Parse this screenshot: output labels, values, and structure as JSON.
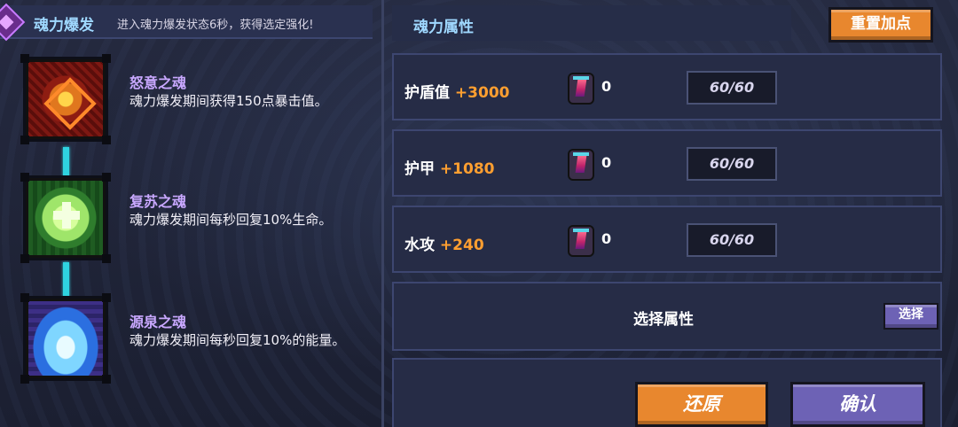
{
  "soul_burst": {
    "title": "魂力爆发",
    "description": "进入魂力爆发状态6秒，获得选定强化!"
  },
  "souls": [
    {
      "name": "怒意之魂",
      "description": "魂力爆发期间获得150点暴击值。",
      "icon": "rage-soul-icon"
    },
    {
      "name": "复苏之魂",
      "description": "魂力爆发期间每秒回复10%生命。",
      "icon": "revive-soul-icon"
    },
    {
      "name": "源泉之魂",
      "description": "魂力爆发期间每秒回复10%的能量。",
      "icon": "source-soul-icon"
    }
  ],
  "attributes_panel": {
    "title": "魂力属性",
    "reset_label": "重置加点"
  },
  "attributes": [
    {
      "name": "护盾值",
      "bonus": "+3000",
      "gem_count": "0",
      "level": "60/60"
    },
    {
      "name": "护甲",
      "bonus": "+1080",
      "gem_count": "0",
      "level": "60/60"
    },
    {
      "name": "水攻",
      "bonus": "+240",
      "gem_count": "0",
      "level": "60/60"
    }
  ],
  "select_attribute": {
    "label": "选择属性",
    "button_label": "选择"
  },
  "footer": {
    "restore_label": "还原",
    "confirm_label": "确认"
  },
  "colors": {
    "background": "#1d2235",
    "accent_orange": "#e8872e",
    "accent_purple": "#6d62b5",
    "bonus_text": "#ff9f30",
    "header_text": "#9fd8ff",
    "soul_name_text": "#c9a8ff",
    "chain": "#2fd3e0"
  }
}
